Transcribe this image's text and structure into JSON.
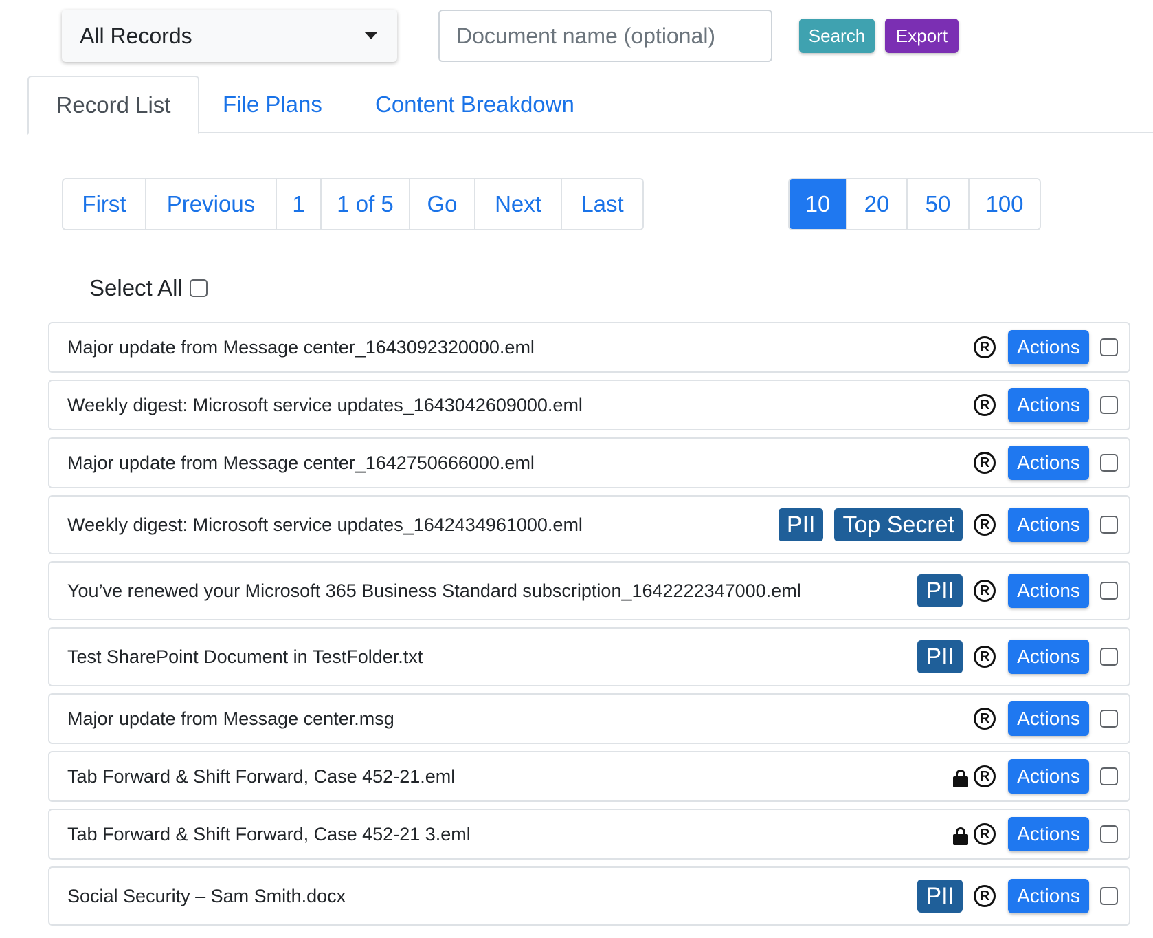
{
  "toolbar": {
    "filter_select": "All Records",
    "document_name_placeholder": "Document name (optional)",
    "search_label": "Search",
    "export_label": "Export"
  },
  "tabs": [
    {
      "label": "Record List",
      "active": true
    },
    {
      "label": "File Plans",
      "active": false
    },
    {
      "label": "Content Breakdown",
      "active": false
    }
  ],
  "pagination": {
    "first": "First",
    "previous": "Previous",
    "page_input": "1",
    "page_of": "1 of 5",
    "go": "Go",
    "next": "Next",
    "last": "Last"
  },
  "page_sizes": [
    {
      "label": "10",
      "active": true
    },
    {
      "label": "20",
      "active": false
    },
    {
      "label": "50",
      "active": false
    },
    {
      "label": "100",
      "active": false
    }
  ],
  "select_all_label": "Select All",
  "actions_label": "Actions",
  "registered_symbol": "R",
  "records": [
    {
      "name": "Major update from Message center_1643092320000.eml",
      "badges": [],
      "locked": false
    },
    {
      "name": "Weekly digest: Microsoft service updates_1643042609000.eml",
      "badges": [],
      "locked": false
    },
    {
      "name": "Major update from Message center_1642750666000.eml",
      "badges": [],
      "locked": false
    },
    {
      "name": "Weekly digest: Microsoft service updates_1642434961000.eml",
      "badges": [
        "PII",
        "Top Secret"
      ],
      "locked": false
    },
    {
      "name": "You’ve renewed your Microsoft 365 Business Standard subscription_1642222347000.eml",
      "badges": [
        "PII"
      ],
      "locked": false
    },
    {
      "name": "Test SharePoint Document in TestFolder.txt",
      "badges": [
        "PII"
      ],
      "locked": false
    },
    {
      "name": "Major update from Message center.msg",
      "badges": [],
      "locked": false
    },
    {
      "name": "Tab Forward & Shift Forward, Case 452-21.eml",
      "badges": [],
      "locked": true
    },
    {
      "name": "Tab Forward & Shift Forward, Case 452-21 3.eml",
      "badges": [],
      "locked": true
    },
    {
      "name": "Social Security – Sam Smith.docx",
      "badges": [
        "PII"
      ],
      "locked": false
    }
  ],
  "colors": {
    "primary": "#1f78f0",
    "search_button": "#3fa2b0",
    "export_button": "#7b2fb3",
    "badge": "#1f5f99"
  }
}
